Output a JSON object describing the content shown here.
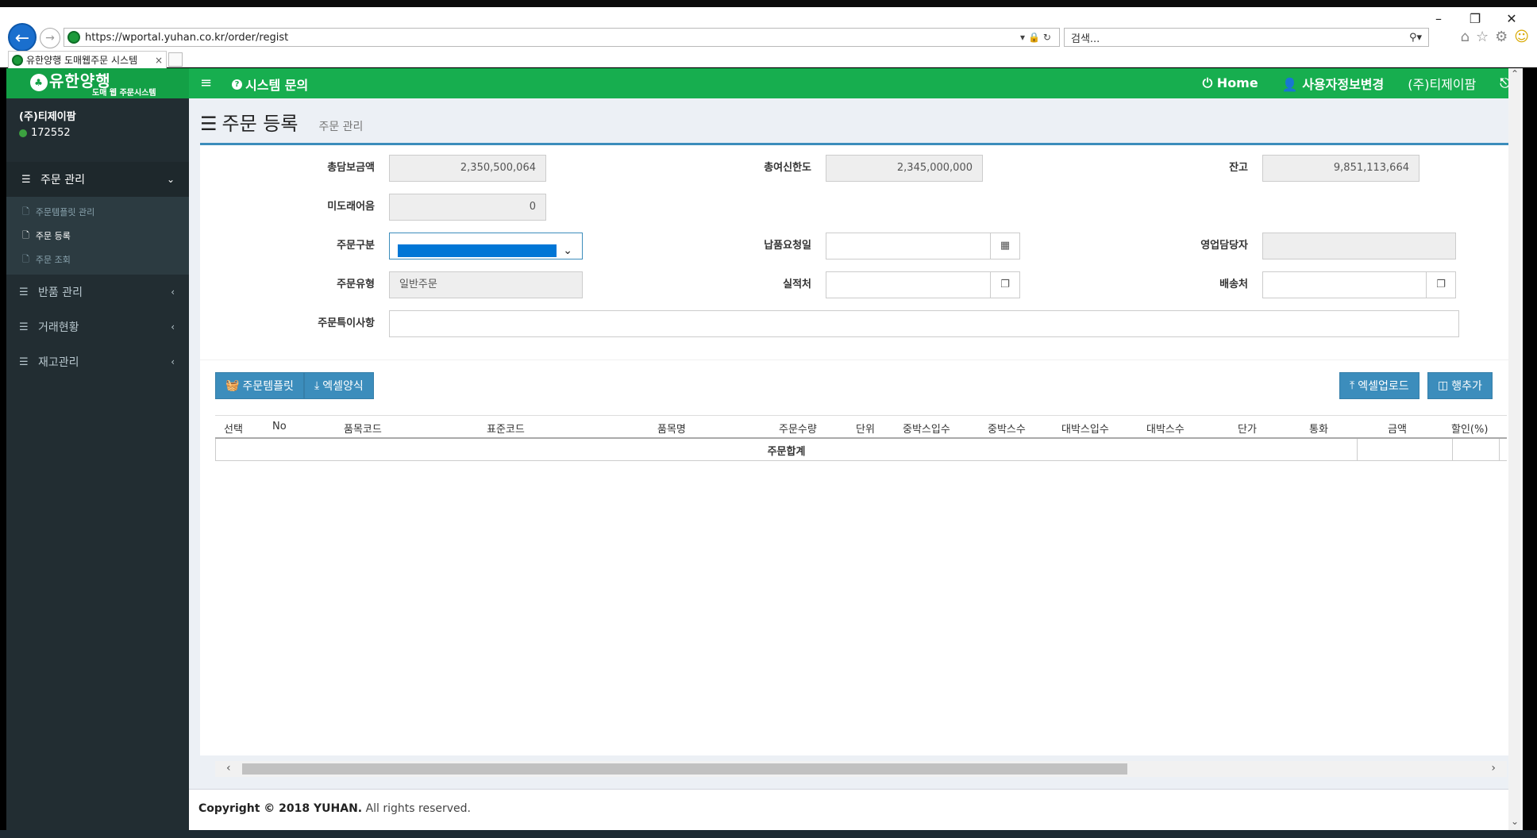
{
  "browser": {
    "url": "https://wportal.yuhan.co.kr/order/regist",
    "search_placeholder": "검색...",
    "tab_title": "유한양행 도매웹주문 시스템",
    "tab_close": "×",
    "win_min": "–",
    "win_restore": "❐",
    "win_close": "✕"
  },
  "header": {
    "logo_text": "유한양행",
    "logo_sub": "도매 웹 주문시스템",
    "menu_icon": "≡",
    "inquiry": "시스템 문의",
    "home": "Home",
    "user_edit": "사용자정보변경",
    "company": "(주)티제이팜"
  },
  "sidebar": {
    "user_name": "(주)티제이팜",
    "user_id": "172552",
    "menu": [
      {
        "label": "주문 관리",
        "expanded": true,
        "sub": [
          "주문템플릿 관리",
          "주문 등록",
          "주문 조회"
        ]
      },
      {
        "label": "반품 관리"
      },
      {
        "label": "거래현황"
      },
      {
        "label": "재고관리"
      }
    ]
  },
  "page": {
    "title": "주문 등록",
    "subtitle": "주문 관리"
  },
  "form": {
    "total_collateral_label": "총담보금액",
    "total_collateral": "2,350,500,064",
    "total_credit_label": "총여신한도",
    "total_credit": "2,345,000,000",
    "balance_label": "잔고",
    "balance": "9,851,113,664",
    "uncollected_label": "미도래어음",
    "uncollected": "0",
    "order_class_label": "주문구분",
    "delivery_date_label": "납품요청일",
    "sales_rep_label": "영업담당자",
    "order_type_label": "주문유형",
    "order_type": "일반주문",
    "performance_label": "실적처",
    "shipping_label": "배송처",
    "remarks_label": "주문특이사항"
  },
  "buttons": {
    "template": "주문템플릿",
    "excel_form": "엑셀양식",
    "excel_upload": "엑셀업로드",
    "add_row": "행추가"
  },
  "table": {
    "columns": [
      "선택",
      "No",
      "품목코드",
      "표준코드",
      "품목명",
      "주문수량",
      "단위",
      "중박스입수",
      "중박스수",
      "대박스입수",
      "대박스수",
      "단가",
      "통화",
      "금액",
      "할인(%)"
    ],
    "footer_label": "주문합계"
  },
  "footer": {
    "copyright": "Copyright © 2018 YUHAN.",
    "rights": "All rights reserved."
  },
  "colors": {
    "brand_green": "#17ae4f",
    "sidebar_bg": "#222d32",
    "primary_blue": "#3c8dbc"
  }
}
